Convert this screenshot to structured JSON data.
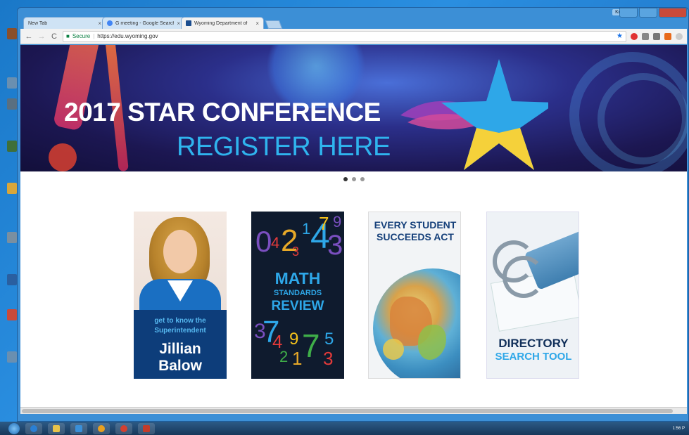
{
  "browser": {
    "tabs": [
      {
        "title": "New Tab",
        "active": false,
        "favicon_color": "#cfd8e0"
      },
      {
        "title": "G meeting - Google Search",
        "active": false,
        "favicon_color": "#4285f4"
      },
      {
        "title": "Wyoming Department of",
        "active": true,
        "favicon_color": "#1a4d8f"
      }
    ],
    "tab_close": "×",
    "user_badge": "Kenya",
    "nav": {
      "back": "←",
      "forward": "→",
      "reload": "C"
    },
    "address": {
      "secure_label": "Secure",
      "separator": "|",
      "url": "https://edu.wyoming.gov"
    },
    "bookmark_star": "★",
    "extensions": [
      "#e03131",
      "#888888",
      "#777777",
      "#e86a1a",
      "#cccccc"
    ]
  },
  "hero": {
    "title": "2017 STAR CONFERENCE",
    "subtitle": "REGISTER HERE",
    "carousel_count": 3,
    "carousel_active": 0
  },
  "tiles": {
    "superintendent": {
      "line1": "get to know the",
      "line2": "Superintendent",
      "name1": "Jillian",
      "name2": "Balow"
    },
    "math": {
      "top_digits": [
        {
          "d": "0",
          "c": "#7a4fbf"
        },
        {
          "d": "4",
          "c": "#e23a3a"
        },
        {
          "d": "2",
          "c": "#e8a928"
        },
        {
          "d": "3",
          "c": "#e23a3a"
        },
        {
          "d": "1",
          "c": "#2ea7e8"
        },
        {
          "d": "4",
          "c": "#2ea7e8"
        },
        {
          "d": "7",
          "c": "#f5c21b"
        },
        {
          "d": "3",
          "c": "#7a4fbf"
        },
        {
          "d": "9",
          "c": "#7a4fbf"
        }
      ],
      "title1": "MATH",
      "title2": "STANDARDS",
      "title3": "REVIEW",
      "bottom_digits": [
        {
          "d": "3",
          "c": "#7a4fbf"
        },
        {
          "d": "7",
          "c": "#2ea7e8"
        },
        {
          "d": "4",
          "c": "#e23a3a"
        },
        {
          "d": "2",
          "c": "#3fae49"
        },
        {
          "d": "9",
          "c": "#f5c21b"
        },
        {
          "d": "1",
          "c": "#e8a928"
        },
        {
          "d": "7",
          "c": "#3fae49"
        },
        {
          "d": "5",
          "c": "#2ea7e8"
        },
        {
          "d": "3",
          "c": "#e23a3a"
        }
      ]
    },
    "essa": {
      "line1": "EVERY STUDENT",
      "line2": "SUCCEEDS ACT"
    },
    "directory": {
      "line1": "DIRECTORY",
      "line2": "SEARCH TOOL"
    }
  },
  "taskbar": {
    "apps": [
      "#2a7fd4",
      "#e8c34a",
      "#3a8fd8",
      "#e8a020",
      "#d24030",
      "#c43b2a"
    ],
    "clock": "1:56 P"
  },
  "colors": {
    "accent_blue": "#2fb4ee",
    "hero_dark": "#1c1752",
    "navy": "#0d3d7a"
  }
}
